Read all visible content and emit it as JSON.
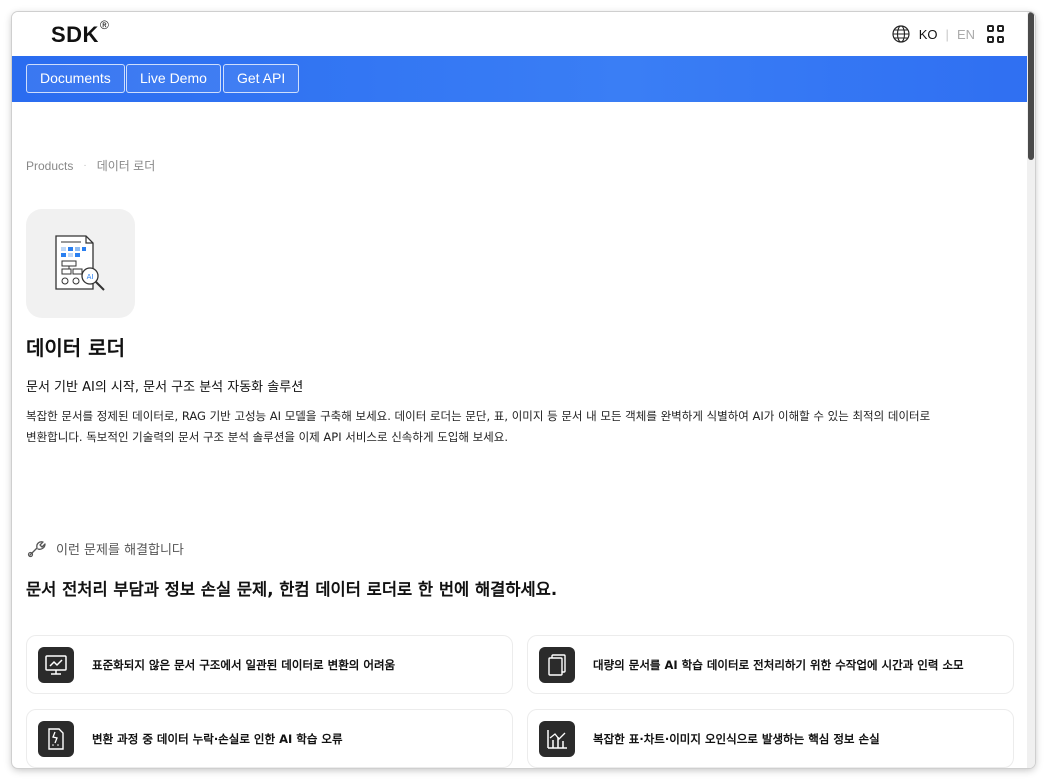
{
  "header": {
    "logo": "SDK",
    "logo_mark": "®",
    "lang_current": "KO",
    "lang_separator": "|",
    "lang_other": "EN",
    "icons": [
      "globe-icon",
      "apps-grid-icon"
    ]
  },
  "nav": {
    "buttons": [
      {
        "label": "Documents"
      },
      {
        "label": "Live Demo"
      },
      {
        "label": "Get API"
      }
    ]
  },
  "breadcrumb": {
    "items": [
      "Products",
      "데이터 로더"
    ],
    "separator": "·"
  },
  "product": {
    "icon": "document-ai-analysis-icon",
    "title": "데이터 로더",
    "subtitle": "문서 기반 AI의 시작, 문서 구조 분석 자동화 솔루션",
    "description_line1": "복잡한 문서를 정제된 데이터로, RAG 기반 고성능 AI 모델을 구축해 보세요. 데이터 로더는 문단, 표, 이미지 등 문서 내 모든 객체를 완벽하게 식별하여 AI가 이해할 수 있는 최적의 데이터로",
    "description_line2": "변환합니다. 독보적인 기술력의 문서 구조 분석 솔루션을 이제 API 서비스로 신속하게 도입해 보세요."
  },
  "problems": {
    "eyebrow": "이런 문제를 해결합니다",
    "eyebrow_icon": "wrench-icon",
    "heading": "문서 전처리 부담과 정보 손실 문제, 한컴 데이터 로더로 한 번에 해결하세요.",
    "cards": [
      {
        "icon": "monitor-chart-icon",
        "text": "표준화되지 않은 문서 구조에서 일관된 데이터로 변환의 어려움"
      },
      {
        "icon": "stacked-documents-icon",
        "text": "대량의 문서를 AI 학습 데이터로 전처리하기 위한 수작업에 시간과 인력 소모"
      },
      {
        "icon": "broken-document-icon",
        "text": "변환 과정 중 데이터 누락·손실로 인한 AI 학습 오류"
      },
      {
        "icon": "bar-chart-icon",
        "text": "복잡한 표·차트·이미지 오인식으로 발생하는 핵심 정보 손실"
      }
    ]
  },
  "colors": {
    "nav_blue": "#2f6ff2",
    "text_dark": "#111111",
    "muted": "#888888"
  }
}
